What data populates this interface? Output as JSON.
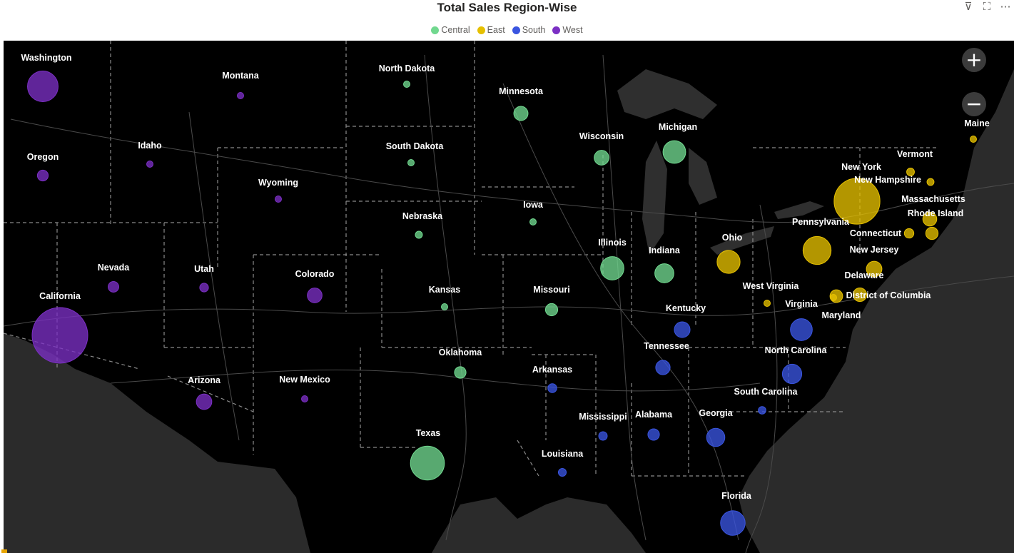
{
  "title": "Total Sales Region-Wise",
  "legend": [
    {
      "label": "Central",
      "color": "#71d88f"
    },
    {
      "label": "East",
      "color": "#e6c000"
    },
    {
      "label": "South",
      "color": "#3a55e0"
    },
    {
      "label": "West",
      "color": "#7b2fc4"
    }
  ],
  "header_icons": [
    "filter-icon",
    "focus-mode-icon",
    "more-options-icon"
  ],
  "header_glyphs": {
    "filter": "⊽",
    "focus": "⛶",
    "more": "⋯"
  },
  "zoom": {
    "in_label": "+",
    "out_label": "−"
  },
  "map_colors": {
    "land": "#000000",
    "ocean": "#2b2b2b",
    "lake": "#2f2f2f",
    "border": "#8a8a8a",
    "road": "#4a4a4a"
  },
  "states": [
    {
      "name": "Washington",
      "region": "West",
      "sales": 138641
    },
    {
      "name": "Montana",
      "region": "West",
      "sales": 5589
    },
    {
      "name": "Oregon",
      "region": "West",
      "sales": 17431
    },
    {
      "name": "Idaho",
      "region": "West",
      "sales": 4382
    },
    {
      "name": "Wyoming",
      "region": "West",
      "sales": 1603
    },
    {
      "name": "Nevada",
      "region": "West",
      "sales": 16729
    },
    {
      "name": "Utah",
      "region": "West",
      "sales": 11220
    },
    {
      "name": "Colorado",
      "region": "West",
      "sales": 32108
    },
    {
      "name": "California",
      "region": "West",
      "sales": 457688
    },
    {
      "name": "Arizona",
      "region": "West",
      "sales": 35282
    },
    {
      "name": "New Mexico",
      "region": "West",
      "sales": 4784
    },
    {
      "name": "North Dakota",
      "region": "Central",
      "sales": 920
    },
    {
      "name": "South Dakota",
      "region": "Central",
      "sales": 1316
    },
    {
      "name": "Minnesota",
      "region": "Central",
      "sales": 29863
    },
    {
      "name": "Wisconsin",
      "region": "Central",
      "sales": 32115
    },
    {
      "name": "Michigan",
      "region": "Central",
      "sales": 76270
    },
    {
      "name": "Iowa",
      "region": "Central",
      "sales": 4580
    },
    {
      "name": "Nebraska",
      "region": "Central",
      "sales": 7465
    },
    {
      "name": "Illinois",
      "region": "Central",
      "sales": 80166
    },
    {
      "name": "Indiana",
      "region": "Central",
      "sales": 53555
    },
    {
      "name": "Kansas",
      "region": "Central",
      "sales": 2914
    },
    {
      "name": "Missouri",
      "region": "Central",
      "sales": 22205
    },
    {
      "name": "Oklahoma",
      "region": "Central",
      "sales": 19683
    },
    {
      "name": "Texas",
      "region": "Central",
      "sales": 170188
    },
    {
      "name": "Ohio",
      "region": "East",
      "sales": 78258
    },
    {
      "name": "Pennsylvania",
      "region": "East",
      "sales": 116512
    },
    {
      "name": "New York",
      "region": "East",
      "sales": 310876
    },
    {
      "name": "Vermont",
      "region": "East",
      "sales": 8929
    },
    {
      "name": "New Hampshire",
      "region": "East",
      "sales": 7293
    },
    {
      "name": "Maine",
      "region": "East",
      "sales": 1271
    },
    {
      "name": "Massachusetts",
      "region": "East",
      "sales": 28634
    },
    {
      "name": "Rhode Island",
      "region": "East",
      "sales": 22628
    },
    {
      "name": "Connecticut",
      "region": "East",
      "sales": 13384
    },
    {
      "name": "New Jersey",
      "region": "East",
      "sales": 35764
    },
    {
      "name": "Delaware",
      "region": "East",
      "sales": 27451
    },
    {
      "name": "Maryland",
      "region": "East",
      "sales": 23706
    },
    {
      "name": "District of Columbia",
      "region": "East",
      "sales": 2865
    },
    {
      "name": "West Virginia",
      "region": "East",
      "sales": 1210
    },
    {
      "name": "Kentucky",
      "region": "South",
      "sales": 36592
    },
    {
      "name": "Virginia",
      "region": "South",
      "sales": 70637
    },
    {
      "name": "Tennessee",
      "region": "South",
      "sales": 30662
    },
    {
      "name": "North Carolina",
      "region": "South",
      "sales": 55603
    },
    {
      "name": "Arkansas",
      "region": "South",
      "sales": 11678
    },
    {
      "name": "South Carolina",
      "region": "South",
      "sales": 8482
    },
    {
      "name": "Mississippi",
      "region": "South",
      "sales": 10771
    },
    {
      "name": "Alabama",
      "region": "South",
      "sales": 19511
    },
    {
      "name": "Georgia",
      "region": "South",
      "sales": 49096
    },
    {
      "name": "Louisiana",
      "region": "South",
      "sales": 9217
    },
    {
      "name": "Florida",
      "region": "South",
      "sales": 89474
    }
  ]
}
